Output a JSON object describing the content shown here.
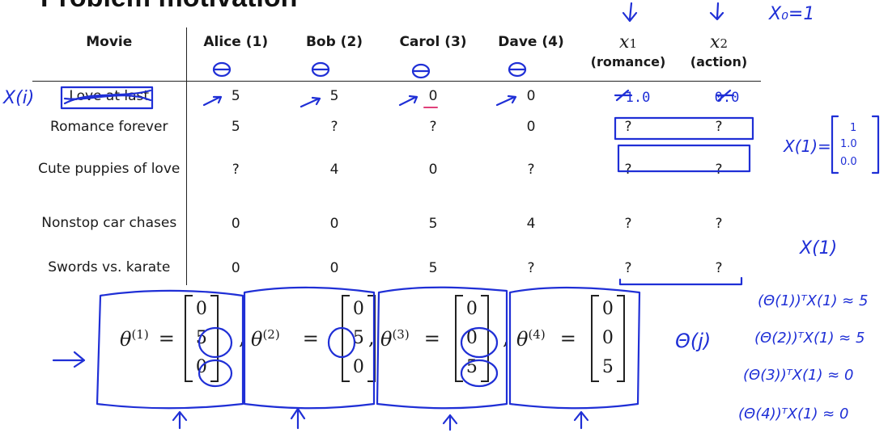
{
  "slide": {
    "title": "Problem motivation"
  },
  "table": {
    "headers": {
      "movie": "Movie",
      "users": [
        "Alice (1)",
        "Bob (2)",
        "Carol (3)",
        "Dave (4)"
      ],
      "features": [
        {
          "symbol": "x",
          "sub": "1",
          "name": "(romance)"
        },
        {
          "symbol": "x",
          "sub": "2",
          "name": "(action)"
        }
      ]
    },
    "rows": [
      {
        "movie": "Love at last",
        "ratings": [
          "5",
          "5",
          "0",
          "0"
        ],
        "features": [
          "1.0",
          "0.0"
        ]
      },
      {
        "movie": "Romance forever",
        "ratings": [
          "5",
          "?",
          "?",
          "0"
        ],
        "features": [
          "?",
          "?"
        ]
      },
      {
        "movie": "Cute puppies of love",
        "ratings": [
          "?",
          "4",
          "0",
          "?"
        ],
        "features": [
          "?",
          "?"
        ]
      },
      {
        "movie": "Nonstop car chases",
        "ratings": [
          "0",
          "0",
          "5",
          "4"
        ],
        "features": [
          "?",
          "?"
        ]
      },
      {
        "movie": "Swords vs. karate",
        "ratings": [
          "0",
          "0",
          "5",
          "?"
        ],
        "features": [
          "?",
          "?"
        ]
      }
    ]
  },
  "thetas": [
    {
      "name": "θ",
      "sup": "(1)",
      "values": [
        "0",
        "5",
        "0"
      ]
    },
    {
      "name": "θ",
      "sup": "(2)",
      "values": [
        "0",
        "5",
        "0"
      ]
    },
    {
      "name": "θ",
      "sup": "(3)",
      "values": [
        "0",
        "0",
        "5"
      ]
    },
    {
      "name": "θ",
      "sup": "(4)",
      "values": [
        "0",
        "0",
        "5"
      ]
    }
  ],
  "annotations": {
    "x0": "X₀=1",
    "x_i_label": "X(i)",
    "x1_vec_label": "X(1)=",
    "x1_vec": [
      "1",
      "1.0",
      "0.0"
    ],
    "x1_label": "X(1)",
    "theta_j": "Θ(j)",
    "products": [
      "(Θ(1))ᵀX(1) ≈ 5",
      "(Θ(2))ᵀX(1) ≈ 5",
      "(Θ(3))ᵀX(1) ≈ 0",
      "(Θ(4))ᵀX(1) ≈ 0"
    ],
    "ink_color": "#1f2fd6",
    "pink": "#e0407a"
  }
}
